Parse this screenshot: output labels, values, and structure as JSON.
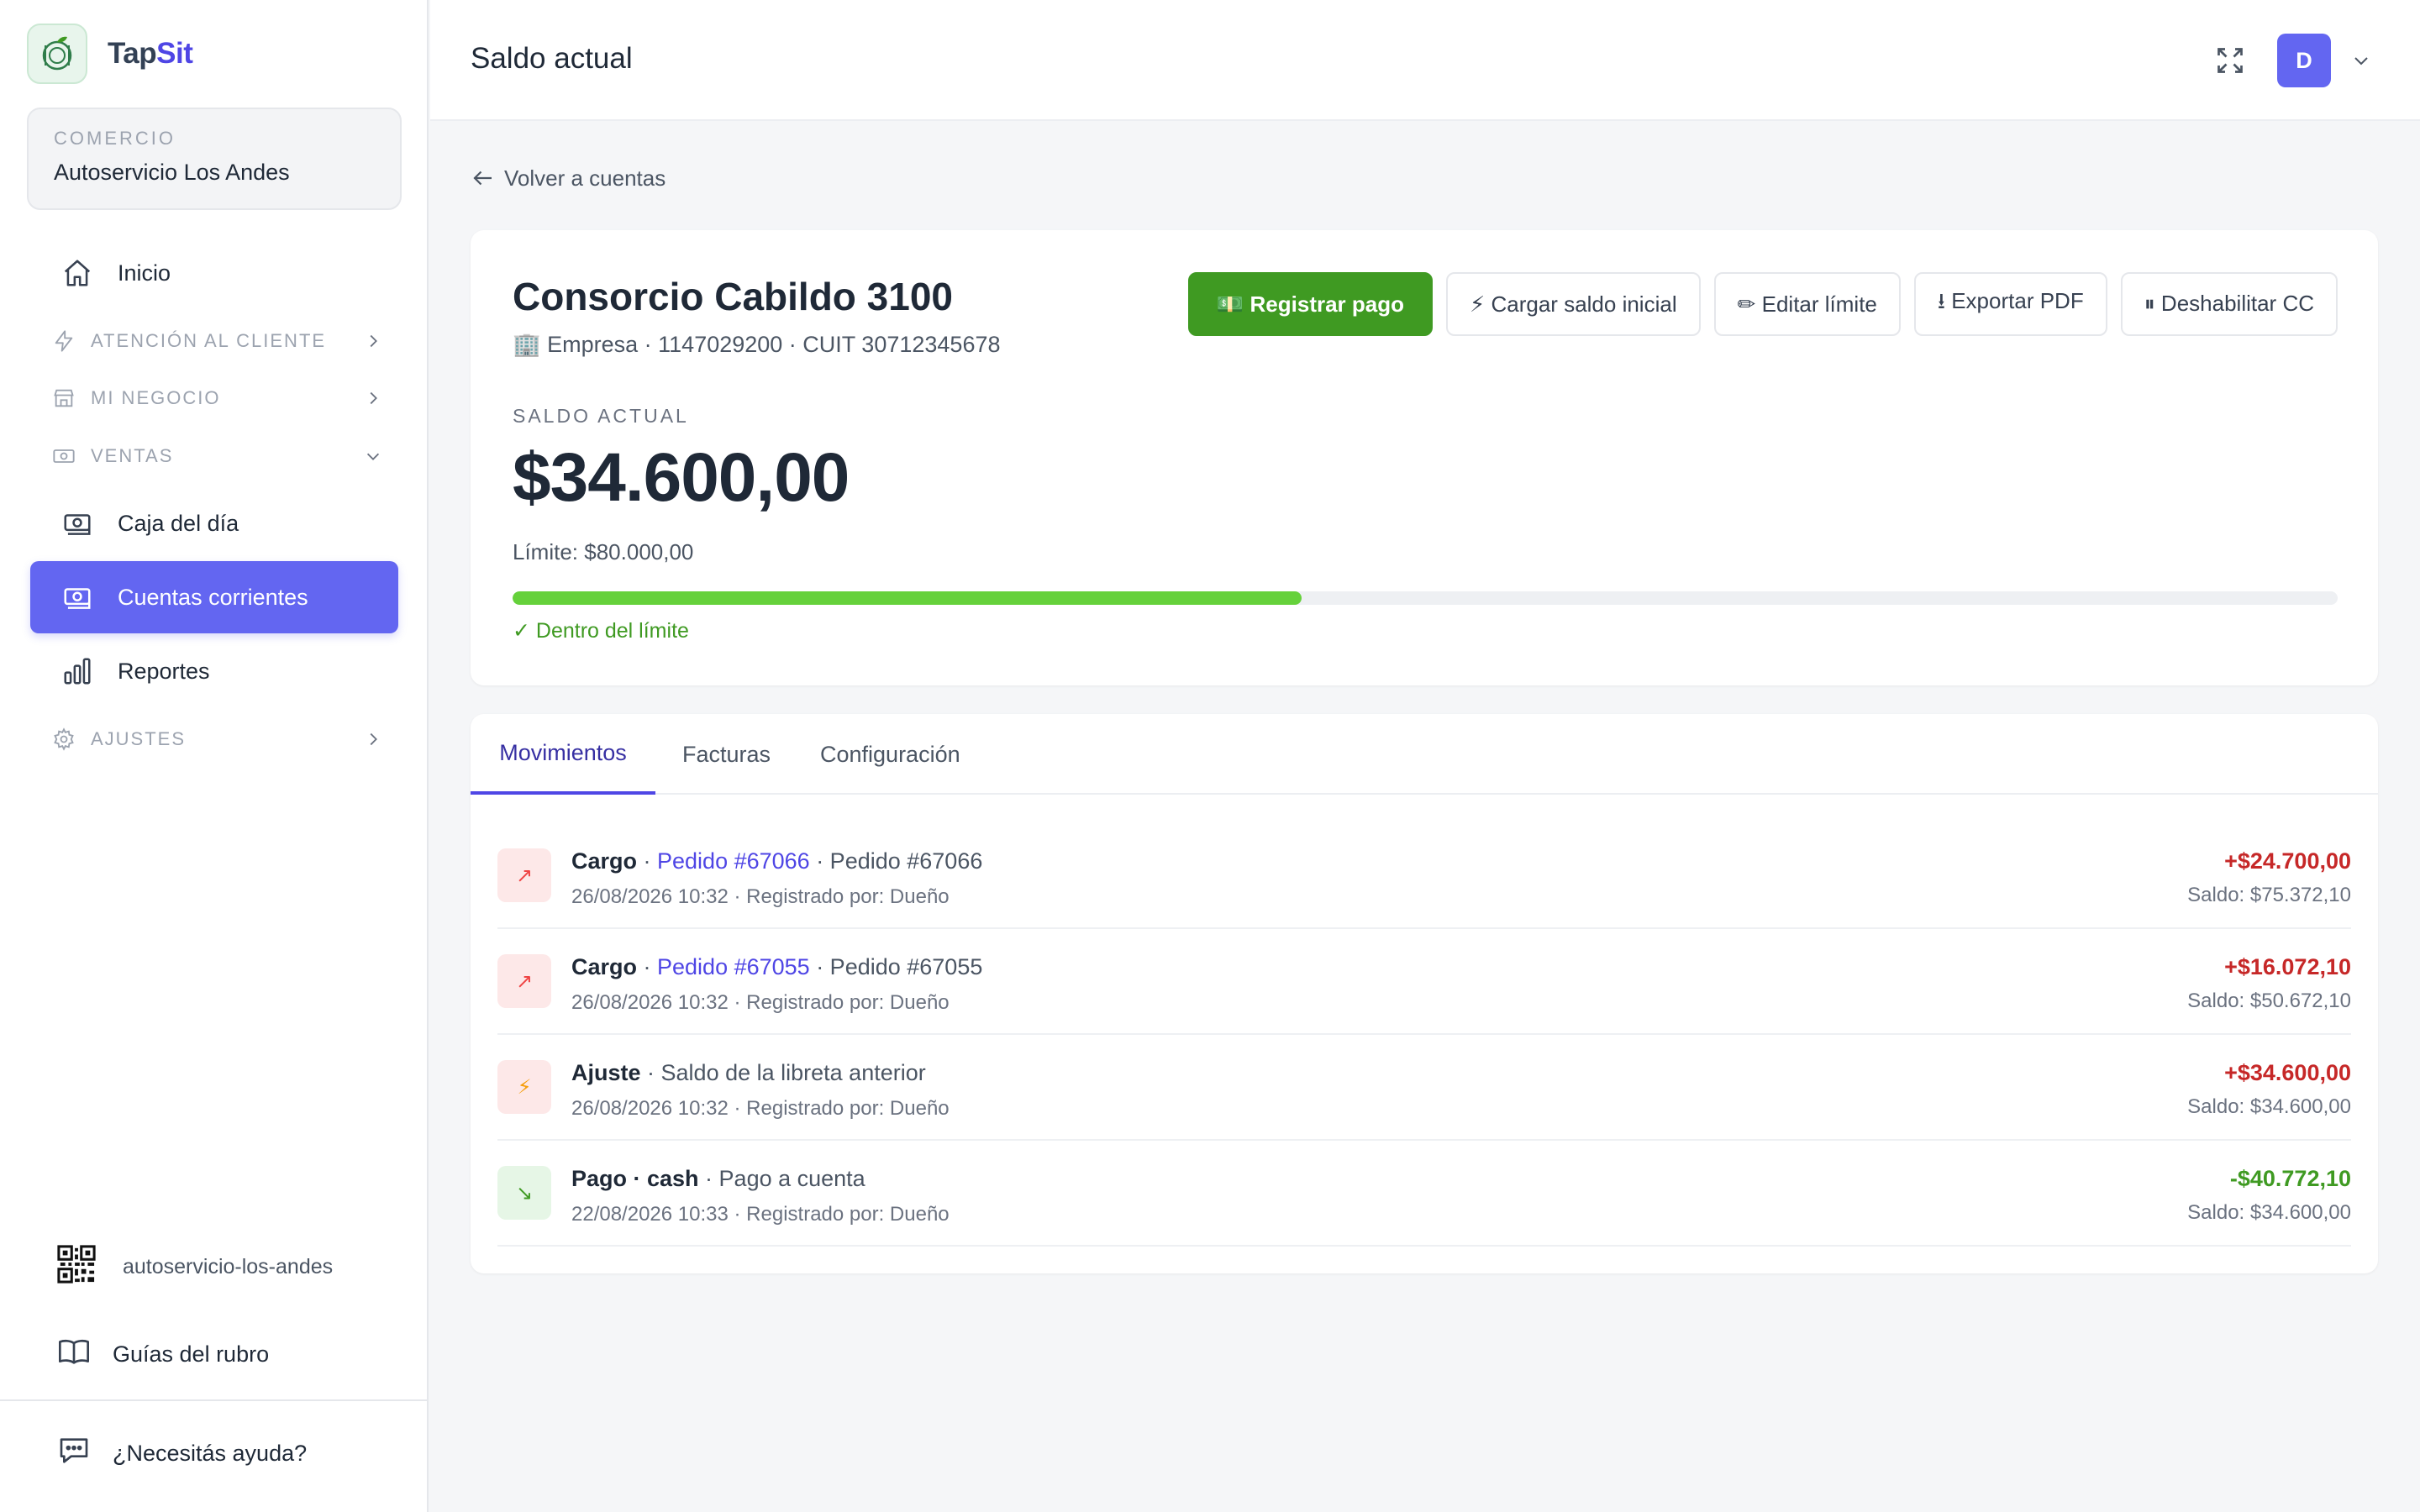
{
  "brand": {
    "name_part1": "Tap",
    "name_part2": "Sit"
  },
  "store": {
    "label": "COMERCIO",
    "name": "Autoservicio Los Andes"
  },
  "nav": {
    "inicio": "Inicio",
    "atencion": "ATENCIÓN AL CLIENTE",
    "negocio": "MI NEGOCIO",
    "ventas": "VENTAS",
    "caja": "Caja del día",
    "cuentas": "Cuentas corrientes",
    "reportes": "Reportes",
    "ajustes": "AJUSTES"
  },
  "sidebar_bottom": {
    "slug": "autoservicio-los-andes",
    "guias": "Guías del rubro",
    "ayuda": "¿Necesitás ayuda?"
  },
  "header": {
    "title": "Saldo actual",
    "avatar_initial": "D"
  },
  "back_link": "Volver a cuentas",
  "account": {
    "name": "Consorcio Cabildo 3100",
    "meta": "🏢 Empresa · 1147029200 · CUIT 30712345678",
    "balance_label": "SALDO ACTUAL",
    "balance": "$34.600,00",
    "limit_text": "Límite: $80.000,00",
    "usage_fraction": 0.4325,
    "within_limit": "✓ Dentro del límite"
  },
  "actions": {
    "registrar": "💵 Registrar pago",
    "cargar": "⚡ Cargar saldo inicial",
    "editar": "✏ Editar límite",
    "exportar": "⭳ Exportar PDF",
    "deshabilitar": "⏸ Deshabilitar CC"
  },
  "tabs": [
    "Movimientos",
    "Facturas",
    "Configuración"
  ],
  "movements": [
    {
      "icon": "↗",
      "type": "Cargo",
      "link": "Pedido #67066",
      "desc": " · Pedido #67066",
      "sub": "26/08/2026 10:32 · Registrado por: Dueño",
      "amount": "+$24.700,00",
      "balance": "Saldo: $75.372,10"
    },
    {
      "icon": "↗",
      "type": "Cargo",
      "link": "Pedido #67055",
      "desc": " · Pedido #67055",
      "sub": "26/08/2026 10:32 · Registrado por: Dueño",
      "amount": "+$16.072,10",
      "balance": "Saldo: $50.672,10"
    },
    {
      "icon": "⚡",
      "type": "Ajuste",
      "link": "",
      "desc": " · Saldo de la libreta anterior",
      "sub": "26/08/2026 10:32 · Registrado por: Dueño",
      "amount": "+$34.600,00",
      "balance": "Saldo: $34.600,00"
    },
    {
      "icon": "↘",
      "type": "Pago · cash",
      "link": "",
      "desc": " · Pago a cuenta",
      "sub": "22/08/2026 10:33 · Registrado por: Dueño",
      "amount": "-$40.772,10",
      "balance": "Saldo: $34.600,00"
    }
  ],
  "colors": {
    "accent": "#6366f1",
    "success": "#3f9a22",
    "danger": "#c62828"
  }
}
